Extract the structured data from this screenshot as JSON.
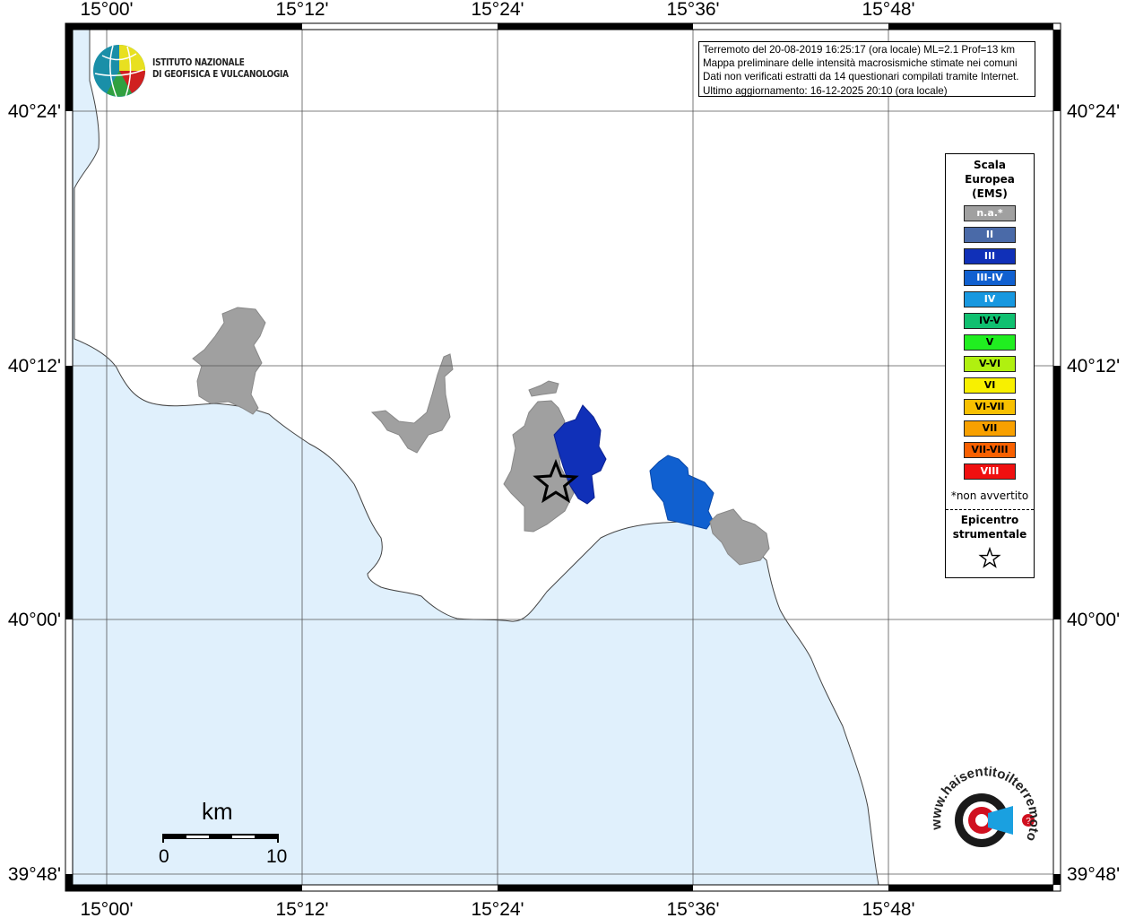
{
  "axes": {
    "lon_labels": [
      "15°00'",
      "15°12'",
      "15°24'",
      "15°36'",
      "15°48'"
    ],
    "lat_labels": [
      "40°24'",
      "40°12'",
      "40°00'",
      "39°48'"
    ]
  },
  "logo": {
    "line1": "ISTITUTO NAZIONALE",
    "line2": "DI GEOFISICA E VULCANOLOGIA"
  },
  "info": {
    "line1": "Terremoto del 20-08-2019 16:25:17 (ora locale) ML=2.1 Prof=13 km",
    "line2": "Mappa preliminare delle intensità macrosismiche stimate nei comuni",
    "line3": "Dati non verificati estratti da 14 questionari compilati tramite Internet.",
    "line4": "Ultimo aggiornamento: 16-12-2025 20:10 (ora locale)"
  },
  "legend": {
    "title": "Scala\nEuropea\n(EMS)",
    "items": [
      {
        "label": "n.a.*",
        "color": "#a0a0a0",
        "text_color": "#ffffff"
      },
      {
        "label": "II",
        "color": "#4a6aa8",
        "text_color": "#ffffff"
      },
      {
        "label": "III",
        "color": "#1030b8",
        "text_color": "#ffffff"
      },
      {
        "label": "III-IV",
        "color": "#1060d0",
        "text_color": "#ffffff"
      },
      {
        "label": "IV",
        "color": "#1898e0",
        "text_color": "#ffffff"
      },
      {
        "label": "IV-V",
        "color": "#10c070",
        "text_color": "#000000"
      },
      {
        "label": "V",
        "color": "#20ee20",
        "text_color": "#000000"
      },
      {
        "label": "V-VI",
        "color": "#b0f010",
        "text_color": "#000000"
      },
      {
        "label": "VI",
        "color": "#f8f000",
        "text_color": "#000000"
      },
      {
        "label": "VI-VII",
        "color": "#f8c000",
        "text_color": "#000000"
      },
      {
        "label": "VII",
        "color": "#f8a000",
        "text_color": "#000000"
      },
      {
        "label": "VII-VIII",
        "color": "#f86000",
        "text_color": "#000000"
      },
      {
        "label": "VIII",
        "color": "#f01010",
        "text_color": "#ffffff"
      }
    ],
    "non_avvertito": "*non avvertito",
    "epicenter_title": "Epicentro\nstrumentale"
  },
  "scale_bar": {
    "unit": "km",
    "start": "0",
    "end": "10"
  },
  "colors": {
    "sea": "#e0f0fc",
    "land": "#ffffff",
    "na": "#a0a0a0",
    "intensity_III": "#1030b8",
    "intensity_III_IV": "#1060d0"
  },
  "watermark": {
    "text": "www.haisentitoilterremoto.it"
  }
}
